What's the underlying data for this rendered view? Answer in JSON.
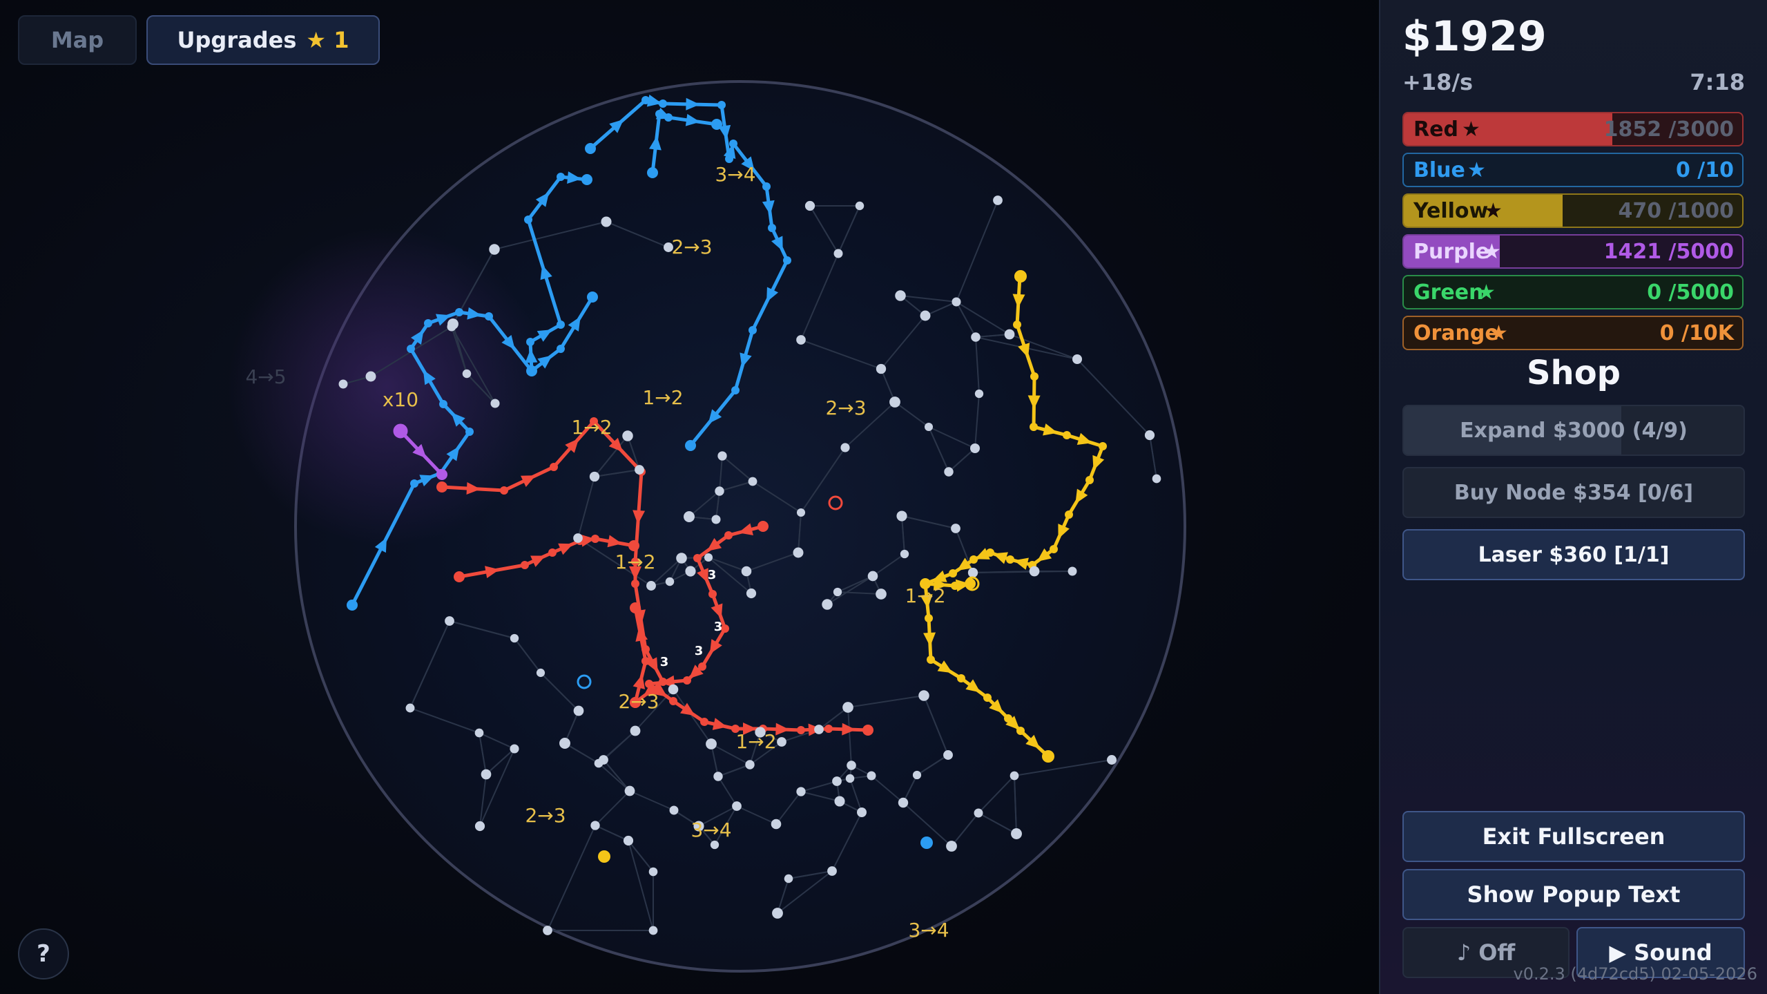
{
  "topbar": {
    "map_label": "Map",
    "upgrades_label": "Upgrades",
    "upgrades_star": "★",
    "upgrades_count": "1"
  },
  "help_label": "?",
  "stats": {
    "money": "$1929",
    "rate": "+18/s",
    "timer": "7:18"
  },
  "resources": [
    {
      "name": "Red",
      "value": "1852 /3000",
      "fraction": 0.617,
      "color": "#e24444",
      "bg": "#2a1318"
    },
    {
      "name": "Blue",
      "value": "0 /10",
      "fraction": 0,
      "color": "#2f9bf0",
      "bg": "#0f1b2c"
    },
    {
      "name": "Yellow",
      "value": "470 /1000",
      "fraction": 0.47,
      "color": "#d9b320",
      "bg": "#22200f"
    },
    {
      "name": "Purple",
      "value": "1421 /5000",
      "fraction": 0.284,
      "color": "#b05ae6",
      "bg": "#1e1329"
    },
    {
      "name": "Green",
      "value": "0 /5000",
      "fraction": 0,
      "color": "#3ad66a",
      "bg": "#0f2016"
    },
    {
      "name": "Orange",
      "value": "0 /10K",
      "fraction": 0,
      "color": "#f0923a",
      "bg": "#24170e"
    }
  ],
  "resource_star": "★",
  "shop": {
    "title": "Shop",
    "expand": {
      "label": "Expand  $3000  (4/9)",
      "progress": 0.64
    },
    "buy_node": {
      "label": "Buy Node  $354  [0/6]"
    },
    "laser": {
      "label": "Laser  $360  [1/1]"
    }
  },
  "controls": {
    "exit_fullscreen": "Exit Fullscreen",
    "show_popup_text": "Show Popup Text",
    "music": "♪ Off",
    "sound": "▶ Sound"
  },
  "version": "v0.2.3 (4d72cd5) 02-05-2026",
  "board": {
    "colors": {
      "red": "#f04a3c",
      "blue": "#2c9cf2",
      "yellow": "#f5c518",
      "purple": "#b05ae6",
      "node": "#c9d2e2",
      "link": "#2a3448",
      "rim": "#3a3f58"
    },
    "labels": [
      {
        "text": "3→4",
        "color": "#e8c04a"
      },
      {
        "text": "2→3",
        "color": "#e8c04a"
      },
      {
        "text": "1→2",
        "color": "#e8c04a"
      },
      {
        "text": "2→3",
        "color": "#e8c04a"
      },
      {
        "text": "1→2",
        "color": "#e8c04a"
      },
      {
        "text": "x10",
        "color": "#e8c04a"
      },
      {
        "text": "1→2",
        "color": "#e8c04a"
      },
      {
        "text": "1→2",
        "color": "#e8c04a"
      },
      {
        "text": "2→3",
        "color": "#e8c04a"
      },
      {
        "text": "1→2",
        "color": "#e8c04a"
      },
      {
        "text": "2→3",
        "color": "#e8c04a"
      },
      {
        "text": "3→4",
        "color": "#e8c04a"
      },
      {
        "text": "3→4",
        "color": "#e8c04a"
      },
      {
        "text": "4→5",
        "color": "#3a4052"
      },
      {
        "text": "3",
        "color": "#ffffff"
      },
      {
        "text": "3",
        "color": "#ffffff"
      },
      {
        "text": "3",
        "color": "#ffffff"
      },
      {
        "text": "3",
        "color": "#ffffff"
      }
    ]
  }
}
